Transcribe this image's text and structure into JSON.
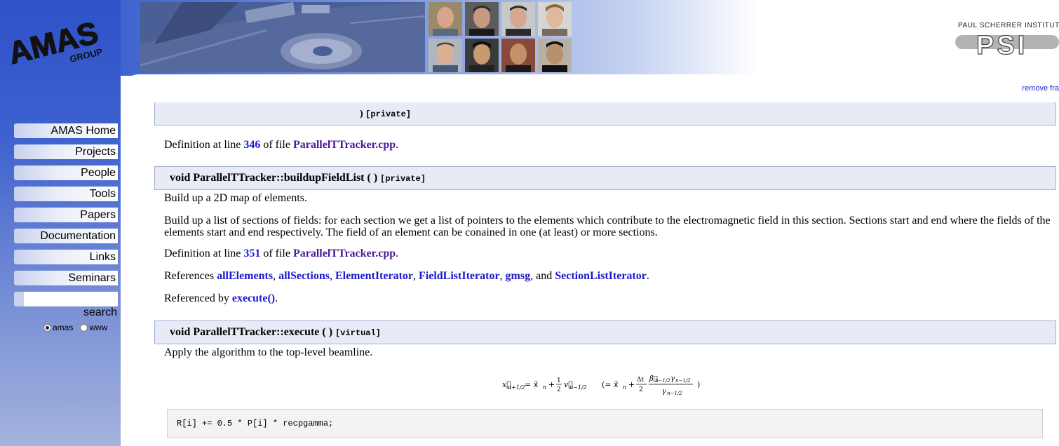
{
  "sidebar": {
    "logo_main": "AMAS",
    "logo_sub": "GROUP",
    "items": [
      {
        "label": "AMAS Home"
      },
      {
        "label": "Projects"
      },
      {
        "label": "People"
      },
      {
        "label": "Tools"
      },
      {
        "label": "Papers"
      },
      {
        "label": "Documentation"
      },
      {
        "label": "Links"
      },
      {
        "label": "Seminars"
      }
    ],
    "search": {
      "value": "",
      "label": "search",
      "options": [
        {
          "label": "amas",
          "checked": true
        },
        {
          "label": "www",
          "checked": false
        }
      ]
    }
  },
  "header": {
    "psi_top": "PAUL SCHERRER INSTITUT",
    "psi_mark": "PSI",
    "remove_frames": "remove fra"
  },
  "doc": {
    "prev_proto": {
      "partial_line": ") ",
      "qualifier": "[private]"
    },
    "def1": {
      "prefix": "Definition at line ",
      "line": "346",
      "mid": " of file ",
      "file": "ParallelTTracker.cpp",
      "suffix": "."
    },
    "buildup": {
      "signature": "void ParallelTTracker::buildupFieldList ( )",
      "qualifier": "[private]",
      "brief": "Build up a 2D map of elements.",
      "detail_line1": "Build up a list of sections of fields: for each section we get a list of pointers to the elements which contribute to the electromagnetic field in this section. Sections start and end where the fields of the",
      "detail_line2": "elements start and end respectively. The field of an element can be conained in one (at least) or more sections.",
      "def_prefix": "Definition at line ",
      "def_line": "351",
      "def_mid": " of file ",
      "def_file": "ParallelTTracker.cpp",
      "def_suffix": ".",
      "refs_prefix": "References ",
      "refs": [
        "allElements",
        "allSections",
        "ElementIterator",
        "FieldListIterator",
        "gmsg",
        "SectionListIterator"
      ],
      "refby_prefix": "Referenced by ",
      "refby": "execute()",
      "refby_suffix": "."
    },
    "execute": {
      "signature": "void ParallelTTracker::execute ( )",
      "qualifier": "[virtual]",
      "brief": "Apply the algorithm to the top-level beamline.",
      "code": "R[i] += 0.5 * P[i] * recpgamma;"
    }
  }
}
